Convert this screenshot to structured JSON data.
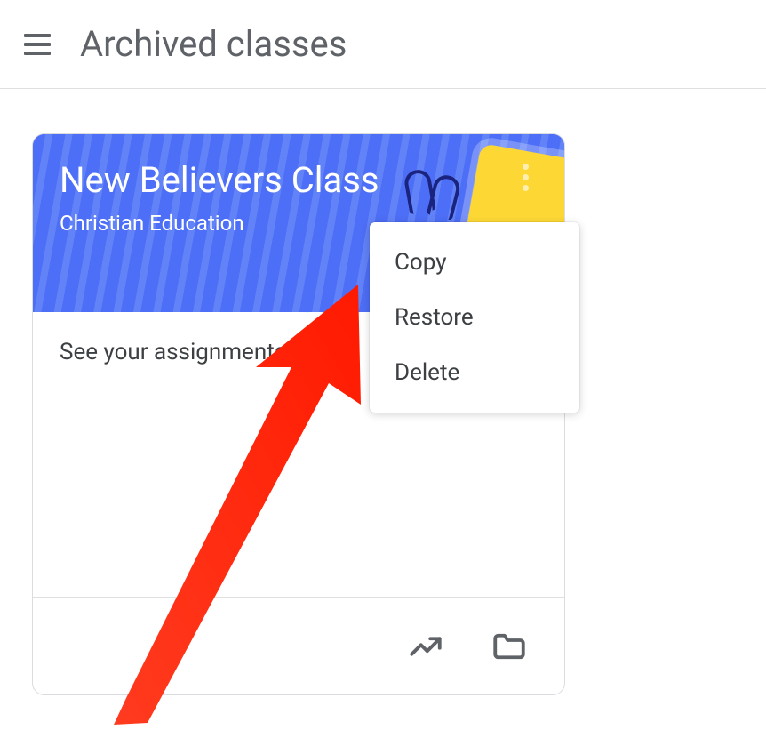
{
  "header": {
    "title": "Archived classes"
  },
  "card": {
    "title": "New Believers Class",
    "subtitle": "Christian Education",
    "assignments_text": "See your assignments"
  },
  "menu": {
    "items": [
      {
        "label": "Copy"
      },
      {
        "label": "Restore"
      },
      {
        "label": "Delete"
      }
    ]
  },
  "colors": {
    "primary_blue": "#4d6ef6",
    "accent_yellow": "#fdd835",
    "annotation_red": "#ff3b1f"
  }
}
